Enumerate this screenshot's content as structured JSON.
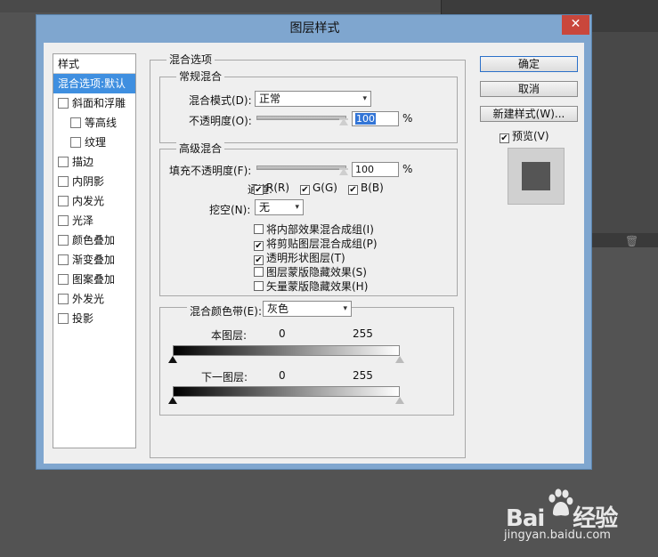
{
  "dialog": {
    "title": "图层样式",
    "close_glyph": "✕"
  },
  "style_list": {
    "header": "样式",
    "items": [
      {
        "label": "混合选项:默认",
        "has_checkbox": false,
        "selected": true
      },
      {
        "label": "斜面和浮雕",
        "has_checkbox": true,
        "checked": false
      },
      {
        "label": "等高线",
        "has_checkbox": true,
        "checked": false,
        "indent": true
      },
      {
        "label": "纹理",
        "has_checkbox": true,
        "checked": false,
        "indent": true
      },
      {
        "label": "描边",
        "has_checkbox": true,
        "checked": false
      },
      {
        "label": "内阴影",
        "has_checkbox": true,
        "checked": false
      },
      {
        "label": "内发光",
        "has_checkbox": true,
        "checked": false
      },
      {
        "label": "光泽",
        "has_checkbox": true,
        "checked": false
      },
      {
        "label": "颜色叠加",
        "has_checkbox": true,
        "checked": false
      },
      {
        "label": "渐变叠加",
        "has_checkbox": true,
        "checked": false
      },
      {
        "label": "图案叠加",
        "has_checkbox": true,
        "checked": false
      },
      {
        "label": "外发光",
        "has_checkbox": true,
        "checked": false
      },
      {
        "label": "投影",
        "has_checkbox": true,
        "checked": false
      }
    ]
  },
  "blending_options": {
    "title": "混合选项",
    "general": {
      "title": "常规混合",
      "blend_mode_label": "混合模式(D):",
      "blend_mode_value": "正常",
      "opacity_label": "不透明度(O):",
      "opacity_value": "100",
      "opacity_fraction": 1.0,
      "percent": "%"
    },
    "advanced": {
      "title": "高级混合",
      "fill_opacity_label": "填充不透明度(F):",
      "fill_opacity_value": "100",
      "fill_opacity_fraction": 1.0,
      "percent": "%",
      "channels_label": "通道:",
      "channels": [
        {
          "label": "R(R)",
          "checked": true
        },
        {
          "label": "G(G)",
          "checked": true
        },
        {
          "label": "B(B)",
          "checked": true
        }
      ],
      "knockout_label": "挖空(N):",
      "knockout_value": "无",
      "options": [
        {
          "label": "将内部效果混合成组(I)",
          "checked": false
        },
        {
          "label": "将剪贴图层混合成组(P)",
          "checked": true
        },
        {
          "label": "透明形状图层(T)",
          "checked": true
        },
        {
          "label": "图层蒙版隐藏效果(S)",
          "checked": false
        },
        {
          "label": "矢量蒙版隐藏效果(H)",
          "checked": false
        }
      ]
    },
    "blend_if": {
      "label": "混合颜色带(E):",
      "value": "灰色",
      "this_layer_label": "本图层:",
      "this_layer_min": "0",
      "this_layer_max": "255",
      "underlying_label": "下一图层:",
      "underlying_min": "0",
      "underlying_max": "255"
    }
  },
  "buttons": {
    "ok": "确定",
    "cancel": "取消",
    "new_style": "新建样式(W)...",
    "preview_label": "预览(V)",
    "preview_checked": true
  },
  "watermark": {
    "brand": "Bai",
    "brand_suffix": "经验",
    "url": "jingyan.baidu.com"
  },
  "check_glyph": "✔",
  "arrow_glyph": "▾",
  "trash_glyph": "🗑"
}
